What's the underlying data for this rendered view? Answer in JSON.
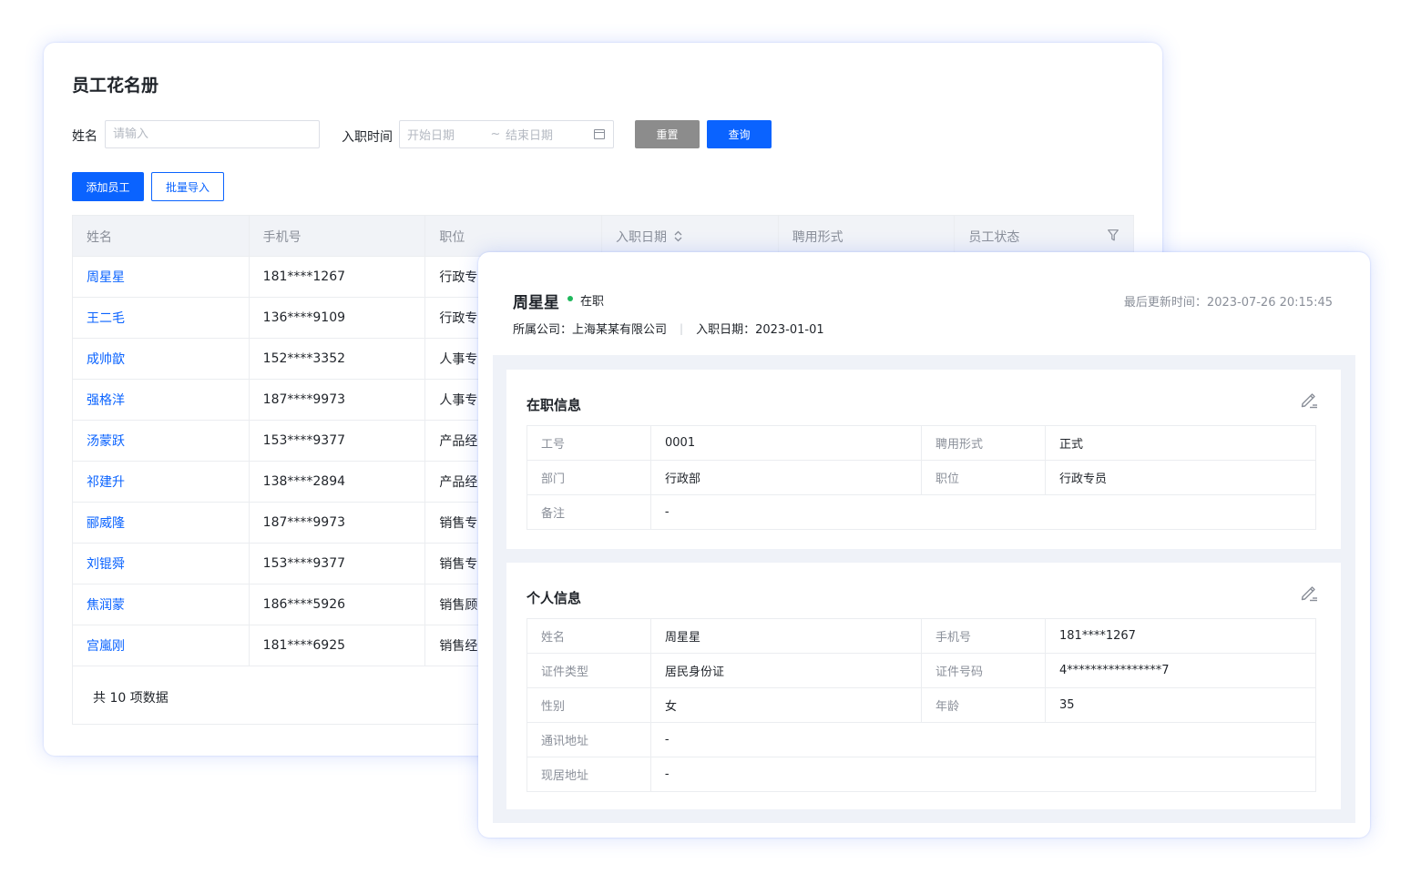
{
  "roster": {
    "title": "员工花名册",
    "filters": {
      "name_label": "姓名",
      "name_placeholder": "请输入",
      "date_label": "入职时间",
      "start_placeholder": "开始日期",
      "separator": "~",
      "end_placeholder": "结束日期"
    },
    "buttons": {
      "reset": "重置",
      "query": "查询",
      "add": "添加员工",
      "import": "批量导入"
    },
    "columns": [
      "姓名",
      "手机号",
      "职位",
      "入职日期",
      "聘用形式",
      "员工状态"
    ],
    "rows": [
      {
        "name": "周星星",
        "phone": "181****1267",
        "position": "行政专员"
      },
      {
        "name": "王二毛",
        "phone": "136****9109",
        "position": "行政专员"
      },
      {
        "name": "成帅歆",
        "phone": "152****3352",
        "position": "人事专员"
      },
      {
        "name": "强格洋",
        "phone": "187****9973",
        "position": "人事专员"
      },
      {
        "name": "汤蒙跃",
        "phone": "153****9377",
        "position": "产品经理"
      },
      {
        "name": "祁建升",
        "phone": "138****2894",
        "position": "产品经理"
      },
      {
        "name": "郦威隆",
        "phone": "187****9973",
        "position": "销售专员"
      },
      {
        "name": "刘锟舜",
        "phone": "153****9377",
        "position": "销售专员"
      },
      {
        "name": "焦润蒙",
        "phone": "186****5926",
        "position": "销售顾问"
      },
      {
        "name": "宫嵐刚",
        "phone": "181****6925",
        "position": "销售经理"
      }
    ],
    "total": "共 10 项数据"
  },
  "detail": {
    "name": "周星星",
    "status": "在职",
    "status_color": "#1fb85c",
    "updated_label": "最后更新时间：",
    "updated_value": "2023-07-26 20:15:45",
    "company": "所属公司：上海某某有限公司",
    "join_date": "入职日期：2023-01-01",
    "employment": {
      "title": "在职信息",
      "fields": {
        "id_key": "工号",
        "id_val": "0001",
        "type_key": "聘用形式",
        "type_val": "正式",
        "dept_key": "部门",
        "dept_val": "行政部",
        "pos_key": "职位",
        "pos_val": "行政专员",
        "remark_key": "备注",
        "remark_val": "-"
      }
    },
    "personal": {
      "title": "个人信息",
      "fields": {
        "name_key": "姓名",
        "name_val": "周星星",
        "phone_key": "手机号",
        "phone_val": "181****1267",
        "idtype_key": "证件类型",
        "idtype_val": "居民身份证",
        "idno_key": "证件号码",
        "idno_val": "4****************7",
        "gender_key": "性别",
        "gender_val": "女",
        "age_key": "年龄",
        "age_val": "35",
        "mail_key": "通讯地址",
        "mail_val": "-",
        "home_key": "现居地址",
        "home_val": "-"
      }
    }
  },
  "colors": {
    "primary": "#0a63ff",
    "reset_button": "#8c8c8c",
    "link": "#0a63ff"
  }
}
